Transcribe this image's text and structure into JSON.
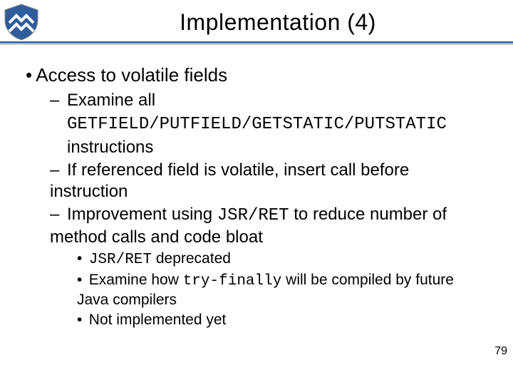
{
  "title": "Implementation (4)",
  "list": {
    "l1": "Access to volatile fields",
    "l2a_pre": "Examine all",
    "code_line": "GETFIELD/PUTFIELD/GETSTATIC/PUTSTATIC",
    "l2a_post": "instructions",
    "l2b": "If referenced field is volatile, insert call before instruction",
    "l2c_pre": "Improvement using ",
    "l2c_code": "JSR/RET",
    "l2c_post": " to reduce number of method calls and code bloat",
    "l3a_code": "JSR/RET",
    "l3a_post": "  deprecated",
    "l3b_pre": "Examine how ",
    "l3b_code": "try-finally",
    "l3b_post": " will be compiled by future Java compilers",
    "l3c": "Not implemented yet"
  },
  "page_number": "79",
  "glyphs": {
    "dot": "•",
    "dash": "–"
  }
}
